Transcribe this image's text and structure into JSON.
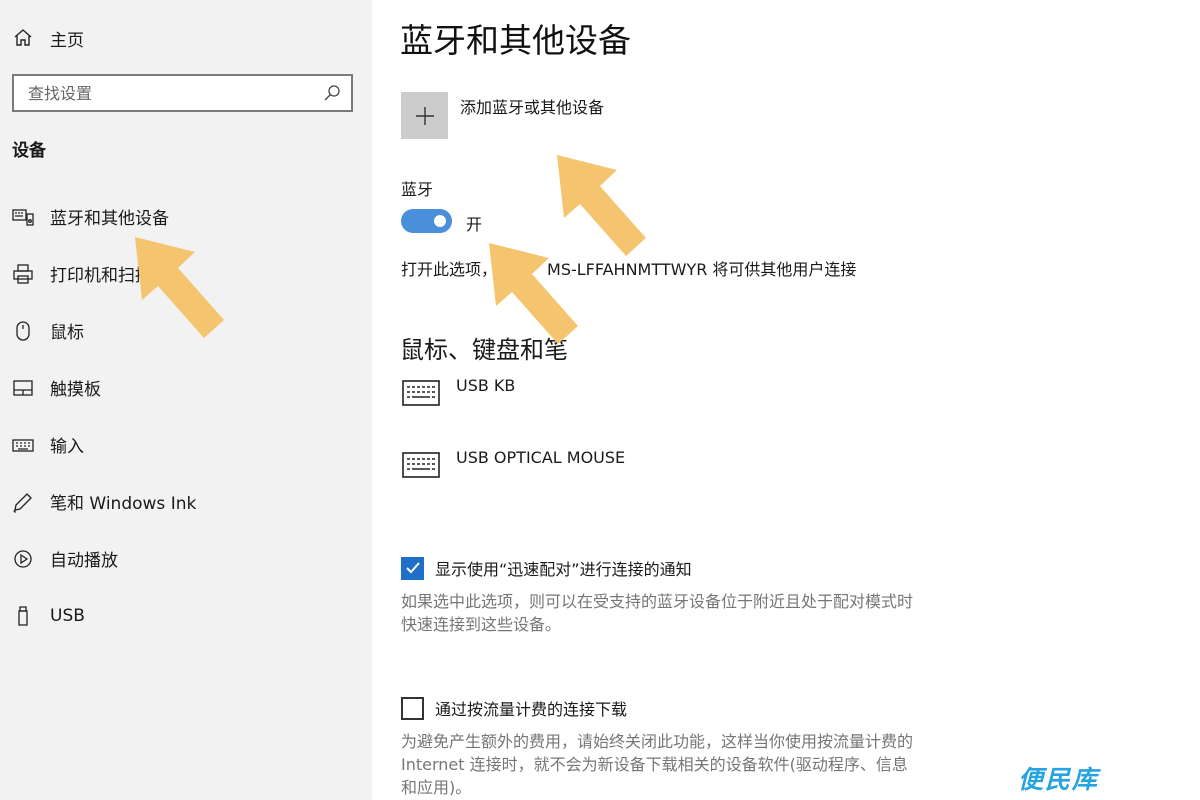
{
  "sidebar": {
    "home_label": "主页",
    "search_placeholder": "查找设置",
    "section_title": "设备",
    "items": [
      {
        "label": "蓝牙和其他设备",
        "icon": "bluetooth-devices-icon"
      },
      {
        "label": "打印机和扫描仪",
        "icon": "printer-icon"
      },
      {
        "label": "鼠标",
        "icon": "mouse-icon"
      },
      {
        "label": "触摸板",
        "icon": "touchpad-icon"
      },
      {
        "label": "输入",
        "icon": "keyboard-icon"
      },
      {
        "label": "笔和 Windows Ink",
        "icon": "pen-icon"
      },
      {
        "label": "自动播放",
        "icon": "autoplay-icon"
      },
      {
        "label": "USB",
        "icon": "usb-icon"
      }
    ]
  },
  "main": {
    "title": "蓝牙和其他设备",
    "add_device_label": "添加蓝牙或其他设备",
    "bluetooth": {
      "label": "蓝牙",
      "state": "开",
      "on": true,
      "desc_prefix": "打开此选项，",
      "desc_suffix": "MS-LFFAHNMTTWYR 将可供其他用户连接"
    },
    "section_title": "鼠标、键盘和笔",
    "devices": [
      {
        "name": "USB KB",
        "icon": "keyboard-icon"
      },
      {
        "name": "USB OPTICAL MOUSE",
        "icon": "keyboard-icon"
      }
    ],
    "swift_pair": {
      "label": "显示使用“迅速配对”进行连接的通知",
      "checked": true,
      "desc_line1": "如果选中此选项，则可以在受支持的蓝牙设备位于附近且处于配对模式时",
      "desc_line2": "快速连接到这些设备。"
    },
    "metered": {
      "label": "通过按流量计费的连接下载",
      "checked": false,
      "desc_line1": "为避免产生额外的费用，请始终关闭此功能，这样当你使用按流量计费的",
      "desc_line2": "Internet 连接时，就不会为新设备下载相关的设备软件(驱动程序、信息",
      "desc_line3": "和应用)。"
    }
  },
  "watermark": "便民库",
  "colors": {
    "sidebar_bg": "#f2f2f2",
    "accent": "#1f6fc9",
    "toggle_on": "#4a8fd9",
    "annotation_arrow": "#f5c46e",
    "watermark": "#26a4e0"
  }
}
